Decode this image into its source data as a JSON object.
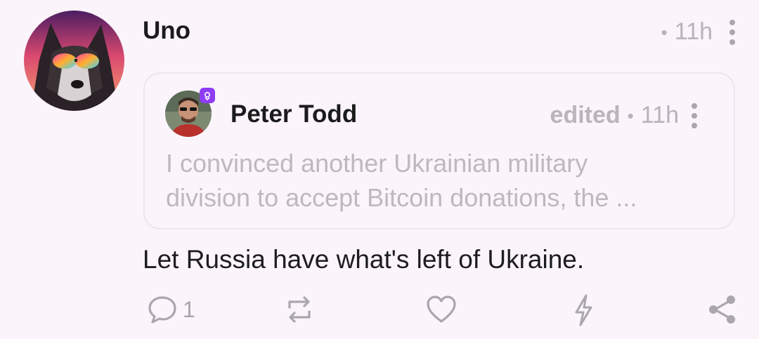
{
  "post": {
    "author": "Uno",
    "dot": "•",
    "time": "11h",
    "body": "Let Russia have what's left of Ukraine."
  },
  "quoted": {
    "author": "Peter Todd",
    "edited": "edited",
    "dot": "•",
    "time": "11h",
    "text_line1": "I convinced another Ukrainian military",
    "text_line2": "division to accept Bitcoin donations, the ..."
  },
  "actions": {
    "reply_count": "1",
    "icons": [
      "comment-icon",
      "repost-icon",
      "heart-icon",
      "zap-icon",
      "share-icon"
    ]
  },
  "colors": {
    "background": "#fbf4fb",
    "muted": "#b7b3ba",
    "badge": "#8e3df4"
  }
}
